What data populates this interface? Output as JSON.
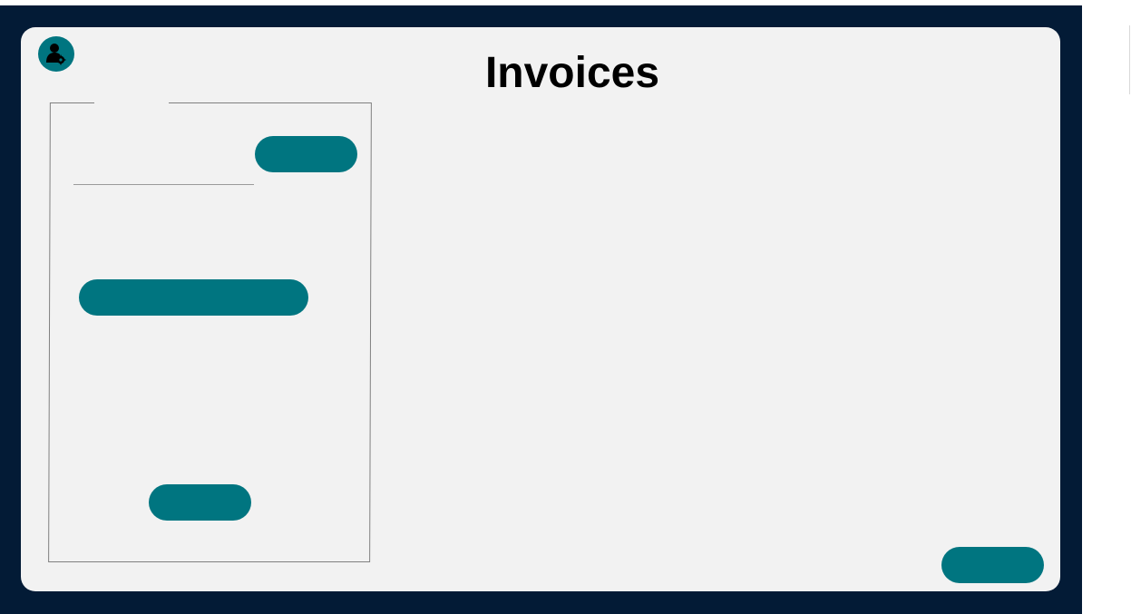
{
  "page": {
    "title": "Invoices"
  },
  "colors": {
    "frame": "#031b36",
    "panel": "#f2f2f2",
    "accent": "#007580",
    "title_text": "#000000"
  },
  "header": {
    "avatar_icon": "user-settings-icon"
  },
  "filter_panel": {
    "legend_label": "",
    "field_value": "",
    "top_button_label": "",
    "wide_button_label": "",
    "bottom_button_label": ""
  },
  "footer": {
    "corner_button_label": ""
  }
}
